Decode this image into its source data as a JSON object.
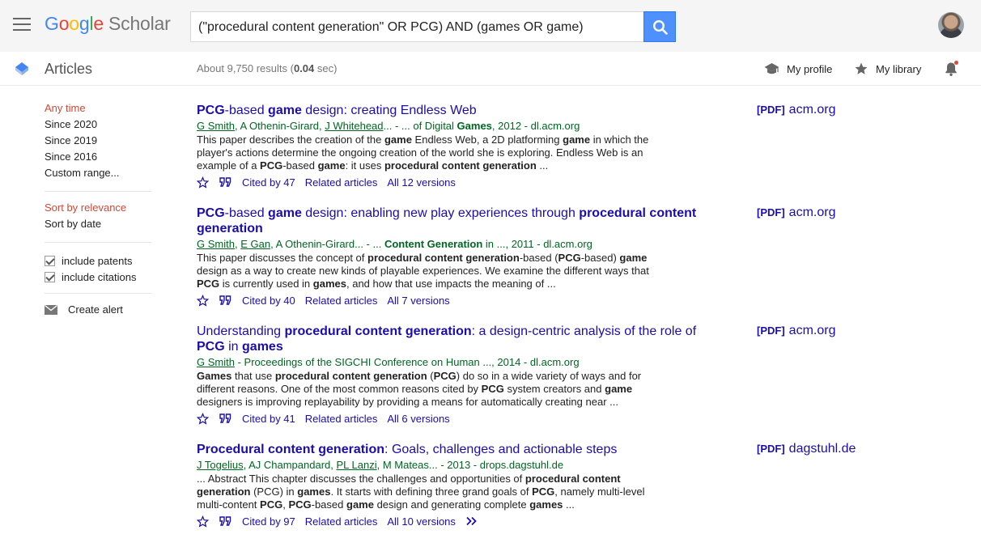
{
  "header": {
    "logo_letters": [
      "G",
      "o",
      "o",
      "g",
      "l",
      "e"
    ],
    "logo_suffix": "Scholar",
    "search_query": "(\"procedural content generation\" OR PCG) AND (games OR game)"
  },
  "subheader": {
    "section": "Articles",
    "results_prefix": "About 9,750 results (",
    "results_time": "0.04",
    "results_suffix": " sec)",
    "my_profile": "My profile",
    "my_library": "My library"
  },
  "sidebar": {
    "time_filters": [
      "Any time",
      "Since 2020",
      "Since 2019",
      "Since 2016",
      "Custom range..."
    ],
    "sort": [
      "Sort by relevance",
      "Sort by date"
    ],
    "checks": [
      "include patents",
      "include citations"
    ],
    "create_alert": "Create alert"
  },
  "results": [
    {
      "title": [
        [
          "b",
          "PCG"
        ],
        [
          "t",
          "-based "
        ],
        [
          "b",
          "game"
        ],
        [
          "t",
          " design: creating Endless Web"
        ]
      ],
      "authors": [
        [
          "u",
          "G Smith"
        ],
        [
          "t",
          ", A Othenin-Girard, "
        ],
        [
          "u",
          "J Whitehead"
        ],
        [
          "t",
          "... - ... of Digital "
        ],
        [
          "b",
          "Games"
        ],
        [
          "t",
          ", 2012 - dl.acm.org"
        ]
      ],
      "snippet": [
        [
          "t",
          "This paper describes the creation of the "
        ],
        [
          "b",
          "game"
        ],
        [
          "t",
          " Endless Web, a 2D platforming "
        ],
        [
          "b",
          "game"
        ],
        [
          "t",
          " in which the player's actions determine the ongoing creation of the world she is exploring. Endless Web is an example of a "
        ],
        [
          "b",
          "PCG"
        ],
        [
          "t",
          "-based "
        ],
        [
          "b",
          "game"
        ],
        [
          "t",
          ": it uses "
        ],
        [
          "b",
          "procedural content generation"
        ],
        [
          "t",
          " ..."
        ]
      ],
      "cited": "Cited by 47",
      "related": "Related articles",
      "versions": "All 12 versions",
      "pdf_tag": "[PDF]",
      "pdf_source": "acm.org"
    },
    {
      "title": [
        [
          "b",
          "PCG"
        ],
        [
          "t",
          "-based "
        ],
        [
          "b",
          "game"
        ],
        [
          "t",
          " design: enabling new play experiences through "
        ],
        [
          "b",
          "procedural content generation"
        ]
      ],
      "authors": [
        [
          "u",
          "G Smith"
        ],
        [
          "t",
          ", "
        ],
        [
          "u",
          "E Gan"
        ],
        [
          "t",
          ", A Othenin-Girard... - ... "
        ],
        [
          "b",
          "Content Generation"
        ],
        [
          "t",
          " in ..., 2011 - dl.acm.org"
        ]
      ],
      "snippet": [
        [
          "t",
          "This paper discusses the concept of "
        ],
        [
          "b",
          "procedural content generation"
        ],
        [
          "t",
          "-based ("
        ],
        [
          "b",
          "PCG"
        ],
        [
          "t",
          "-based) "
        ],
        [
          "b",
          "game"
        ],
        [
          "t",
          " design as a way to create new kinds of playable experiences. We examine the different ways that "
        ],
        [
          "b",
          "PCG"
        ],
        [
          "t",
          " is currently used in "
        ],
        [
          "b",
          "games"
        ],
        [
          "t",
          ", and how that use impacts the meaning of ..."
        ]
      ],
      "cited": "Cited by 40",
      "related": "Related articles",
      "versions": "All 7 versions",
      "pdf_tag": "[PDF]",
      "pdf_source": "acm.org"
    },
    {
      "title": [
        [
          "t",
          "Understanding "
        ],
        [
          "b",
          "procedural content generation"
        ],
        [
          "t",
          ": a design-centric analysis of the role of "
        ],
        [
          "b",
          "PCG"
        ],
        [
          "t",
          " in "
        ],
        [
          "b",
          "games"
        ]
      ],
      "authors": [
        [
          "u",
          "G Smith"
        ],
        [
          "t",
          " - Proceedings of the SIGCHI Conference on Human ..., 2014 - dl.acm.org"
        ]
      ],
      "snippet": [
        [
          "b",
          "Games"
        ],
        [
          "t",
          " that use "
        ],
        [
          "b",
          "procedural content generation"
        ],
        [
          "t",
          " ("
        ],
        [
          "b",
          "PCG"
        ],
        [
          "t",
          ") do so in a wide variety of ways and for different reasons. One of the most common reasons cited by "
        ],
        [
          "b",
          "PCG"
        ],
        [
          "t",
          " system creators and "
        ],
        [
          "b",
          "game"
        ],
        [
          "t",
          " designers is improving replayability by providing a means for automatically creating near ..."
        ]
      ],
      "cited": "Cited by 41",
      "related": "Related articles",
      "versions": "All 6 versions",
      "pdf_tag": "[PDF]",
      "pdf_source": "acm.org"
    },
    {
      "title": [
        [
          "b",
          "Procedural content generation"
        ],
        [
          "t",
          ": Goals, challenges and actionable steps"
        ]
      ],
      "authors": [
        [
          "u",
          "J Togelius"
        ],
        [
          "t",
          ", AJ Champandard, "
        ],
        [
          "u",
          "PL Lanzi"
        ],
        [
          "t",
          ", M Mateas... - 2013 - drops.dagstuhl.de"
        ]
      ],
      "snippet": [
        [
          "t",
          "... Abstract This chapter discusses the challenges and opportunities of "
        ],
        [
          "b",
          "procedural content generation"
        ],
        [
          "t",
          " (PCG) in "
        ],
        [
          "b",
          "games"
        ],
        [
          "t",
          ". It starts with defining three grand goals of "
        ],
        [
          "b",
          "PCG"
        ],
        [
          "t",
          ", namely multi-level multi-content "
        ],
        [
          "b",
          "PCG"
        ],
        [
          "t",
          ", "
        ],
        [
          "b",
          "PCG"
        ],
        [
          "t",
          "-based "
        ],
        [
          "b",
          "game"
        ],
        [
          "t",
          " design and generating complete "
        ],
        [
          "b",
          "games"
        ],
        [
          "t",
          " ..."
        ]
      ],
      "cited": "Cited by 97",
      "related": "Related articles",
      "versions": "All 10 versions",
      "pdf_tag": "[PDF]",
      "pdf_source": "dagstuhl.de"
    }
  ],
  "colors": {
    "link": "#1a0dab",
    "green": "#006621",
    "active": "#d14836",
    "search_btn": "#4d90fe"
  },
  "icons": [
    "menu-icon",
    "search-icon",
    "articles-icon",
    "mortarboard-icon",
    "star-icon",
    "bell-icon",
    "mail-icon",
    "quote-icon",
    "more-icon"
  ]
}
